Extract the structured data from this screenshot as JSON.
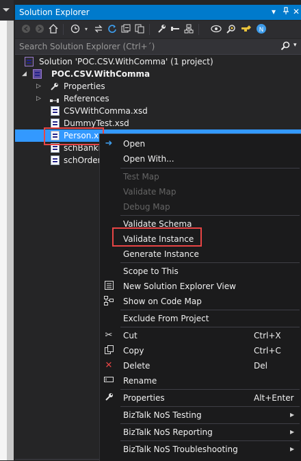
{
  "window": {
    "title": "Solution Explorer",
    "controls": [
      "▾",
      "⊿",
      "✕"
    ]
  },
  "toolbar": {
    "icons": [
      "back-icon",
      "forward-icon",
      "home-icon",
      "history-icon",
      "sync-icon",
      "refresh-icon",
      "collapse-all-icon",
      "show-all-files-icon",
      "properties-icon",
      "pending-changes-icon",
      "class-view-icon",
      "preview-icon",
      "search-filter-icon",
      "git-icon",
      "nos-icon"
    ]
  },
  "search": {
    "placeholder": "Search Solution Explorer (Ctrl+´)"
  },
  "tree": {
    "solution": "Solution 'POC.CSV.WithComma' (1 project)",
    "project": "POC.CSV.WithComma",
    "properties": "Properties",
    "references": "References",
    "files": [
      "CSVWithComma.xsd",
      "DummyTest.xsd",
      "Person.xs",
      "schBanki",
      "schOrder"
    ]
  },
  "menu": {
    "open": "Open",
    "open_with": "Open With...",
    "test_map": "Test Map",
    "validate_map": "Validate Map",
    "debug_map": "Debug Map",
    "validate_schema": "Validate Schema",
    "validate_instance": "Validate Instance",
    "generate_instance": "Generate Instance",
    "scope_to_this": "Scope to This",
    "new_view": "New Solution Explorer View",
    "show_code_map": "Show on Code Map",
    "exclude": "Exclude From Project",
    "cut": "Cut",
    "cut_key": "Ctrl+X",
    "copy": "Copy",
    "copy_key": "Ctrl+C",
    "delete": "Delete",
    "delete_key": "Del",
    "rename": "Rename",
    "properties": "Properties",
    "properties_key": "Alt+Enter",
    "nos_testing": "BizTalk NoS Testing",
    "nos_reporting": "BizTalk NoS Reporting",
    "nos_troubleshooting": "BizTalk NoS Troubleshooting"
  },
  "colors": {
    "accent": "#007acc",
    "selection": "#3399ff",
    "highlight_box": "#e84545",
    "background": "#252526",
    "menu_bg": "#1b1b1c"
  }
}
